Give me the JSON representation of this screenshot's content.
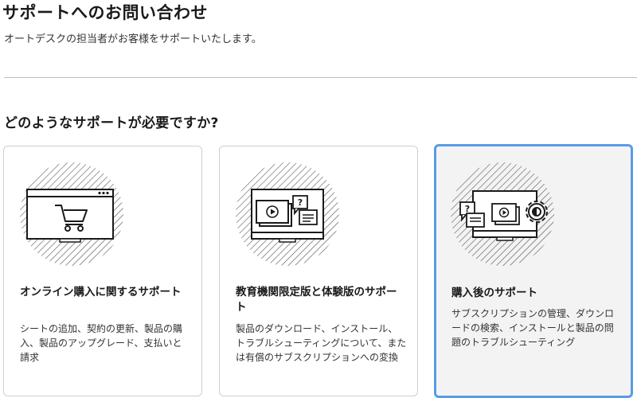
{
  "header": {
    "title": "サポートへのお問い合わせ",
    "subtitle": "オートデスクの担当者がお客様をサポートいたします。"
  },
  "section": {
    "heading": "どのようなサポートが必要ですか?"
  },
  "cards": [
    {
      "title": "オンライン購入に関するサポート",
      "description": "シートの追加、契約の更新、製品の購入、製品のアップグレード、支払いと請求",
      "icon": "shopping-cart-icon",
      "selected": false
    },
    {
      "title": "教育機関限定版と体験版のサポート",
      "description": "製品のダウンロード、インストール、トラブルシューティングについて、または有償のサブスクリプションへの変換",
      "icon": "video-chat-monitor-icon",
      "selected": false
    },
    {
      "title": "購入後のサポート",
      "description": "サブスクリプションの管理、ダウンロードの検索、インストールと製品の問題のトラブルシューティング",
      "icon": "settings-monitor-icon",
      "selected": true
    }
  ],
  "colors": {
    "selected_border": "#5a9be6",
    "selected_background": "#f3f3f3",
    "divider": "#bdbdbd"
  }
}
